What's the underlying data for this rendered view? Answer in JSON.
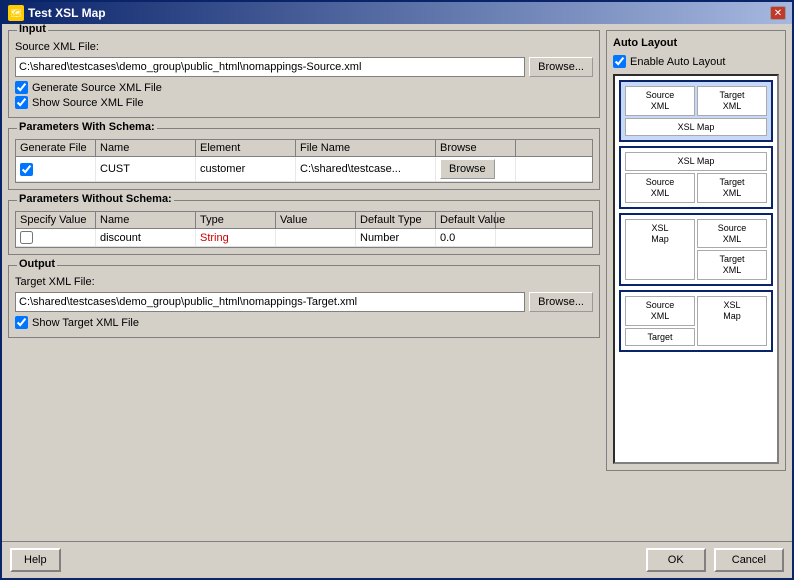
{
  "window": {
    "title": "Test XSL Map",
    "icon": "xsl-icon",
    "close_label": "✕"
  },
  "input_section": {
    "title": "Input",
    "source_xml_label": "Source XML File:",
    "source_xml_value": "C:\\shared\\testcases\\demo_group\\public_html\\nomappings-Source.xml",
    "browse_label": "Browse...",
    "generate_source_label": "Generate Source XML File",
    "generate_source_checked": true,
    "show_source_label": "Show Source XML File",
    "show_source_checked": true
  },
  "params_with_schema": {
    "title": "Parameters With Schema:",
    "columns": [
      "Generate File",
      "Name",
      "Element",
      "File Name",
      "Browse"
    ],
    "rows": [
      {
        "generate_file": true,
        "name": "CUST",
        "element": "customer",
        "filename": "C:\\shared\\testcase...",
        "browse": "Browse"
      }
    ]
  },
  "params_without_schema": {
    "title": "Parameters Without Schema:",
    "columns": [
      "Specify Value",
      "Name",
      "Type",
      "Value",
      "Default Type",
      "Default Value"
    ],
    "rows": [
      {
        "specify_value": false,
        "name": "discount",
        "type": "String",
        "value": "",
        "default_type": "Number",
        "default_value": "0.0"
      }
    ]
  },
  "output_section": {
    "title": "Output",
    "target_xml_label": "Target XML File:",
    "target_xml_value": "C:\\shared\\testcases\\demo_group\\public_html\\nomappings-Target.xml",
    "browse_label": "Browse...",
    "show_target_label": "Show Target XML File",
    "show_target_checked": true
  },
  "auto_layout": {
    "title": "Auto Layout",
    "enable_label": "Enable Auto Layout",
    "enable_checked": true,
    "options": [
      {
        "id": "option1",
        "selected": true,
        "layout": "source-target-xslmap",
        "cells": [
          {
            "text": "Source\nXML",
            "wide": false
          },
          {
            "text": "Target\nXML",
            "wide": false
          },
          {
            "text": "XSL Map",
            "wide": true
          }
        ]
      },
      {
        "id": "option2",
        "selected": false,
        "layout": "xslmap-source-target",
        "cells": [
          {
            "text": "XSL Map",
            "wide": true
          },
          {
            "text": "Source\nXML",
            "wide": false
          },
          {
            "text": "Target\nXML",
            "wide": false
          }
        ]
      },
      {
        "id": "option3",
        "selected": false,
        "layout": "xslmap-left-src-tgt-right",
        "cells": [
          {
            "text": "XSL\nMap",
            "wide": false
          },
          {
            "text": "Source\nXML",
            "wide": false
          },
          {
            "text": "",
            "wide": false
          },
          {
            "text": "Target\nXML",
            "wide": false
          }
        ]
      },
      {
        "id": "option4",
        "selected": false,
        "layout": "source-xslmap-target",
        "cells": [
          {
            "text": "Source\nXML",
            "wide": false
          },
          {
            "text": "",
            "wide": false
          },
          {
            "text": "Target",
            "wide": false
          },
          {
            "text": "XSL\nMap",
            "wide": false
          }
        ]
      }
    ]
  },
  "bottom_bar": {
    "help_label": "Help",
    "ok_label": "OK",
    "cancel_label": "Cancel"
  }
}
